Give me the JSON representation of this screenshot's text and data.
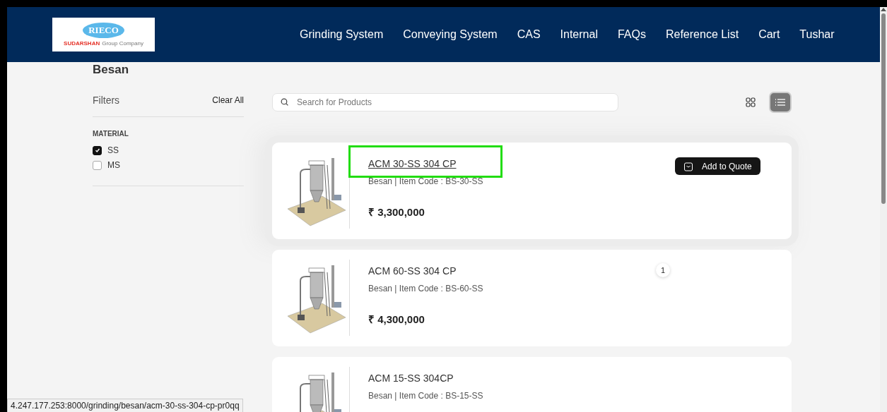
{
  "header": {
    "logo": {
      "brand": "RIECO",
      "group_name": "SUDARSHAN",
      "group_suffix": "Group Company"
    },
    "nav": [
      {
        "label": "Grinding System"
      },
      {
        "label": "Conveying System"
      },
      {
        "label": "CAS"
      },
      {
        "label": "Internal"
      },
      {
        "label": "FAQs"
      },
      {
        "label": "Reference List"
      },
      {
        "label": "Cart"
      },
      {
        "label": "Tushar"
      }
    ]
  },
  "page_title": "Besan",
  "filters": {
    "title": "Filters",
    "clear": "Clear All",
    "groups": [
      {
        "title": "MATERIAL",
        "options": [
          {
            "label": "SS",
            "checked": true
          },
          {
            "label": "MS",
            "checked": false
          }
        ]
      }
    ]
  },
  "search": {
    "placeholder": "Search for Products"
  },
  "view_modes": [
    {
      "kind": "grid",
      "selected": false
    },
    {
      "kind": "list",
      "selected": true
    }
  ],
  "products": [
    {
      "title": "ACM 30-SS 304 CP",
      "subtitle": "Besan | Item Code : BS-30-SS",
      "price": "₹ 3,300,000",
      "hovered": true,
      "highlighted": true,
      "action": "Add to Quote"
    },
    {
      "title": "ACM 60-SS 304 CP",
      "subtitle": "Besan | Item Code : BS-60-SS",
      "price": "₹ 4,300,000",
      "hovered": false,
      "highlighted": false,
      "badge": "1"
    },
    {
      "title": "ACM 15-SS 304CP",
      "subtitle": "Besan | Item Code : BS-15-SS",
      "hovered": false,
      "highlighted": false
    }
  ],
  "status_url": "4.247.177.253:8000/grinding/besan/acm-30-ss-304-cp-pr0qq"
}
